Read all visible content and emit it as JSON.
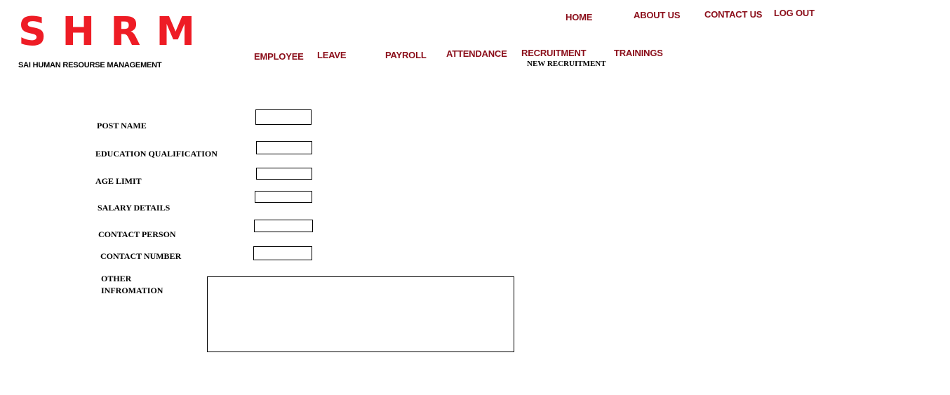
{
  "brand": {
    "logo": "SHRM",
    "tagline": "SAI HUMAN RESOURSE MANAGEMENT",
    "logo_color": "#ee1c25"
  },
  "top_nav": {
    "home": "HOME",
    "about": "ABOUT US",
    "contact": "CONTACT US",
    "logout": "LOG OUT"
  },
  "main_nav": {
    "employee": "EMPLOYEE",
    "leave": "LEAVE",
    "payroll": "PAYROLL",
    "attendance": "ATTENDANCE",
    "recruitment": "RECRUITMENT",
    "recruitment_sub": "NEW RECRUITMENT",
    "trainings": "TRAININGS"
  },
  "nav_color": "#8b0e1a",
  "form": {
    "post_name": {
      "label": "POST NAME",
      "value": ""
    },
    "education": {
      "label": "EDUCATION QUALIFICATION",
      "value": ""
    },
    "age_limit": {
      "label": "AGE LIMIT",
      "value": ""
    },
    "salary": {
      "label": "SALARY DETAILS",
      "value": ""
    },
    "contact_person": {
      "label": "CONTACT PERSON",
      "value": ""
    },
    "contact_number": {
      "label": "CONTACT NUMBER",
      "value": ""
    },
    "other_info": {
      "label": "OTHER INFROMATION",
      "value": ""
    }
  }
}
